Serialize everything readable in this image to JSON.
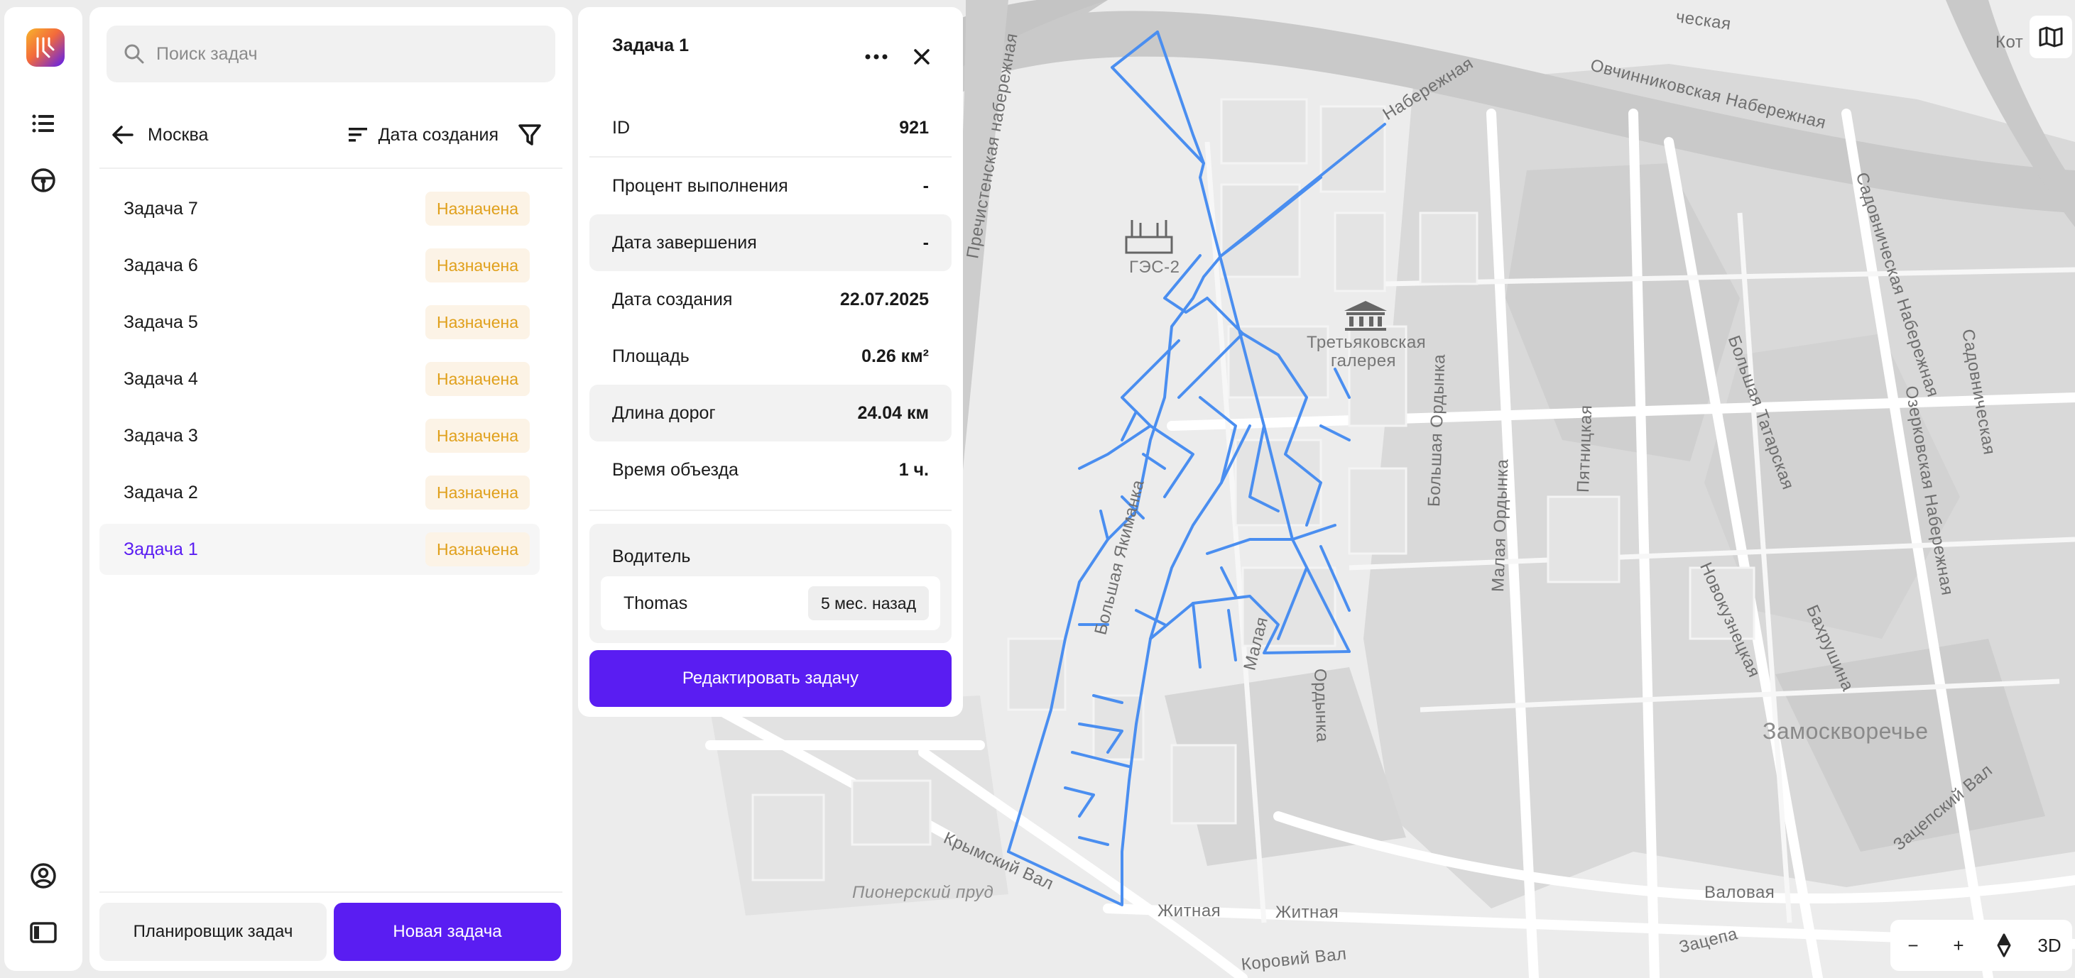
{
  "search": {
    "placeholder": "Поиск задач"
  },
  "list": {
    "city": "Москва",
    "sort_label": "Дата создания",
    "tasks": [
      {
        "name": "Задача 7",
        "status": "Назначена"
      },
      {
        "name": "Задача 6",
        "status": "Назначена"
      },
      {
        "name": "Задача 5",
        "status": "Назначена"
      },
      {
        "name": "Задача 4",
        "status": "Назначена"
      },
      {
        "name": "Задача 3",
        "status": "Назначена"
      },
      {
        "name": "Задача 2",
        "status": "Назначена"
      },
      {
        "name": "Задача 1",
        "status": "Назначена",
        "selected": true
      }
    ],
    "planner_button": "Планировщик задач",
    "new_task_button": "Новая задача"
  },
  "detail": {
    "title": "Задача 1",
    "props": [
      {
        "label": "ID",
        "value": "921"
      },
      {
        "label": "Процент выполнения",
        "value": "-"
      },
      {
        "label": "Дата завершения",
        "value": "-"
      },
      {
        "label": "Дата создания",
        "value": "22.07.2025"
      },
      {
        "label": "Площадь",
        "value": "0.26 км²"
      },
      {
        "label": "Длина дорог",
        "value": "24.04 км"
      },
      {
        "label": "Время объезда",
        "value": "1 ч."
      }
    ],
    "driver_label": "Водитель",
    "driver_name": "Thomas",
    "driver_time": "5 мес. назад",
    "edit_button": "Редактировать задачу"
  },
  "map": {
    "labels": [
      "Пречистенская набережная",
      "Овчинниковская Набережная",
      "Набережная",
      "ческая",
      "Кот",
      "ГЭС-2",
      "Третьяковская галерея",
      "Садовническая Набережная",
      "Садовническая",
      "Большая Татарская",
      "Озерковская Набережная",
      "Большая Ордынка",
      "Малая Ордынка",
      "Пятницкая",
      "Новокузнецкая",
      "Бахрушина",
      "Замоскворечье",
      "Зацепский Вал",
      "Валовая",
      "Зацепа",
      "Крымский Вал",
      "Пионерский пруд",
      "Житная",
      "Житная",
      "Коровий Вал",
      "Большая Якиманка",
      "Малая",
      "Ордынка"
    ],
    "route_color": "#4a8ef0",
    "zoom_out": "−",
    "zoom_in": "+",
    "mode_3d": "3D"
  },
  "colors": {
    "accent": "#5a1df2",
    "badge_text": "#e0a01c",
    "badge_bg": "#fcf3e6"
  }
}
